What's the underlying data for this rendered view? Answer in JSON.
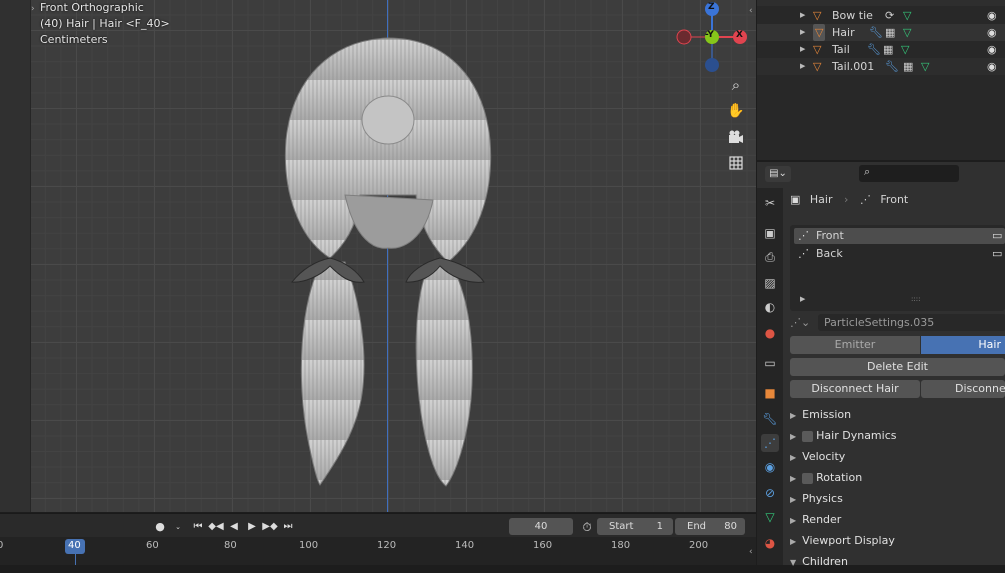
{
  "viewport": {
    "view_name": "Front Orthographic",
    "object_info": "(40) Hair | Hair <F_40>",
    "units": "Centimeters",
    "gizmo": {
      "z": "Z",
      "y": "-Y",
      "x": "X"
    },
    "nav_icons": [
      "zoom-icon",
      "hand-pan-icon",
      "camera-icon",
      "grid-icon"
    ]
  },
  "outliner": {
    "items": [
      {
        "label": "Bow tie"
      },
      {
        "label": "Hair"
      },
      {
        "label": "Tail"
      },
      {
        "label": "Tail.001"
      }
    ]
  },
  "properties": {
    "search_placeholder": "",
    "breadcrumb": {
      "object": "Hair",
      "system": "Front"
    },
    "particle_systems": [
      "Front",
      "Back"
    ],
    "list_expander": "::::",
    "settings_name": "ParticleSettings.035",
    "type_options": [
      "Emitter",
      "Hair"
    ],
    "selected_type": "Hair",
    "delete_edit": "Delete Edit",
    "disconnect_hair": "Disconnect Hair",
    "disconnect_all": "Disconnect",
    "panels": [
      "Emission",
      "Hair Dynamics",
      "Velocity",
      "Rotation",
      "Physics",
      "Render",
      "Viewport Display",
      "Children"
    ]
  },
  "timeline": {
    "current_frame": "40",
    "start_label": "Start",
    "start_value": "1",
    "end_label": "End",
    "end_value": "80",
    "ruler_ticks": [
      "0",
      "40",
      "60",
      "80",
      "100",
      "120",
      "140",
      "160",
      "180",
      "200"
    ]
  },
  "colors": {
    "accent": "#4772b3",
    "object_orange": "#e8883a",
    "mesh_green": "#35c97b",
    "gizmo_x": "#e0444f",
    "gizmo_y": "#86c71a",
    "gizmo_z": "#3a74d8"
  }
}
